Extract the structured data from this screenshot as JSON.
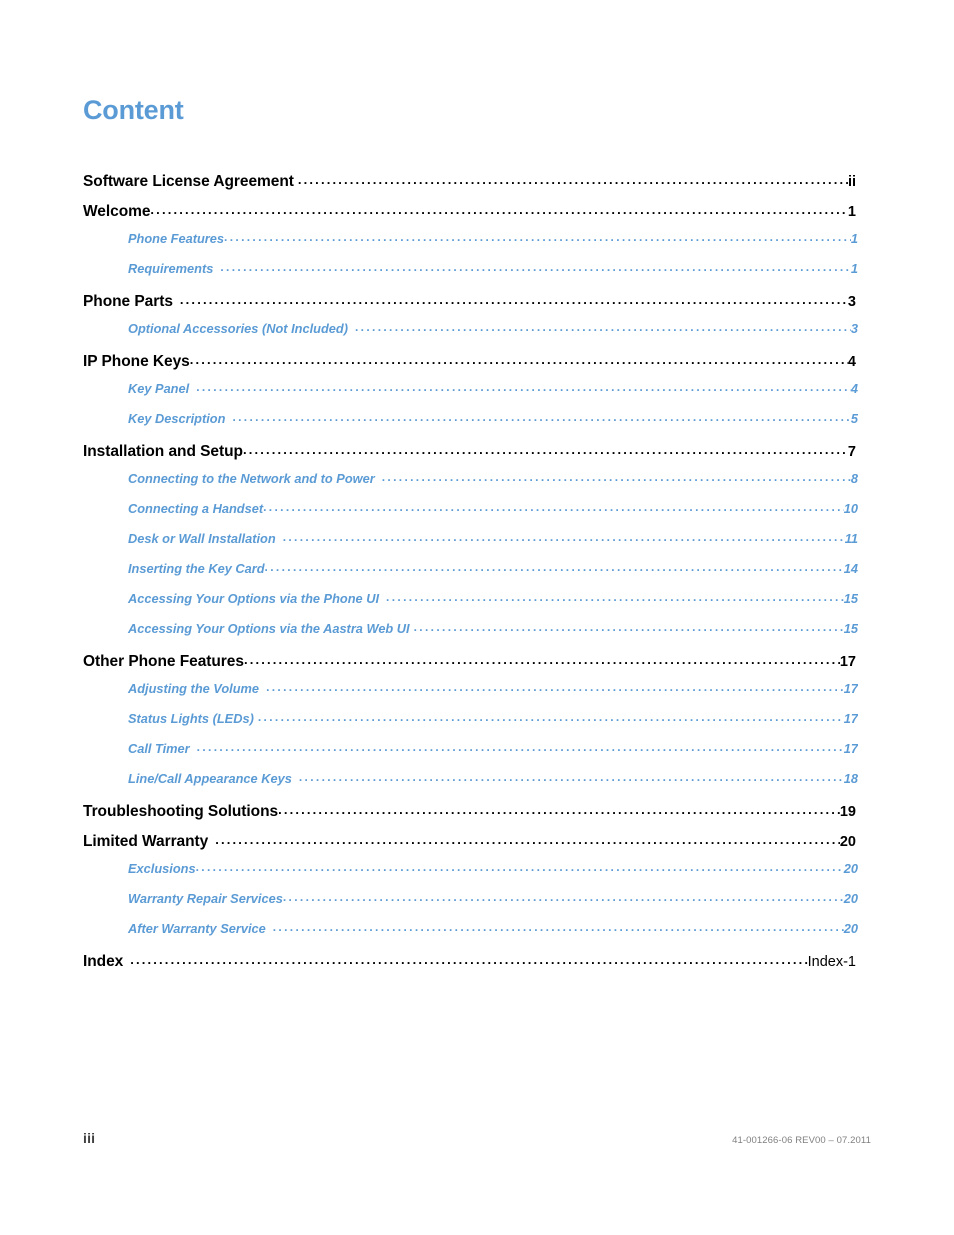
{
  "document": {
    "title": "Content",
    "title_color": "#5B9BD5",
    "level1_color": "#000000",
    "level2_color": "#5B9BD5"
  },
  "toc": {
    "entries": [
      {
        "level": 1,
        "label": "Software License Agreement",
        "page": "ii",
        "gap": 1
      },
      {
        "level": 1,
        "label": "Welcome",
        "page": "1",
        "gap": 0
      },
      {
        "level": 2,
        "label": "Phone Features",
        "page": "1",
        "gap": 0
      },
      {
        "level": 2,
        "label": "Requirements",
        "page": "1",
        "gap": 2
      },
      {
        "level": 1,
        "label": "Phone Parts",
        "page": "3",
        "gap": 2
      },
      {
        "level": 2,
        "label": "Optional Accessories (Not Included)",
        "page": "3",
        "gap": 2
      },
      {
        "level": 1,
        "label": "IP Phone Keys",
        "page": "4",
        "gap": 0
      },
      {
        "level": 2,
        "label": "Key Panel",
        "page": "4",
        "gap": 2
      },
      {
        "level": 2,
        "label": "Key Description",
        "page": "5",
        "gap": 2
      },
      {
        "level": 1,
        "label": "Installation and Setup",
        "page": "7",
        "gap": 0
      },
      {
        "level": 2,
        "label": "Connecting to the Network and to Power",
        "page": "8",
        "gap": 2
      },
      {
        "level": 2,
        "label": "Connecting a Handset",
        "page": "10",
        "gap": 0
      },
      {
        "level": 2,
        "label": "Desk or Wall Installation",
        "page": "11",
        "gap": 2
      },
      {
        "level": 2,
        "label": "Inserting the Key Card",
        "page": "14",
        "gap": 0
      },
      {
        "level": 2,
        "label": "Accessing Your Options via the Phone UI",
        "page": "15",
        "gap": 2
      },
      {
        "level": 2,
        "label": "Accessing Your Options via the Aastra Web UI",
        "page": "15",
        "gap": 1
      },
      {
        "level": 1,
        "label": "Other Phone Features",
        "page": "17",
        "gap": 0
      },
      {
        "level": 2,
        "label": "Adjusting the Volume",
        "page": "17",
        "gap": 2
      },
      {
        "level": 2,
        "label": "Status Lights (LEDs)",
        "page": "17",
        "gap": 1
      },
      {
        "level": 2,
        "label": "Call Timer",
        "page": "17",
        "gap": 2
      },
      {
        "level": 2,
        "label": "Line/Call Appearance Keys",
        "page": "18",
        "gap": 2
      },
      {
        "level": 1,
        "label": "Troubleshooting Solutions",
        "page": "19",
        "gap": 0
      },
      {
        "level": 1,
        "label": "Limited Warranty",
        "page": "20",
        "gap": 2
      },
      {
        "level": 2,
        "label": "Exclusions",
        "page": "20",
        "gap": 0
      },
      {
        "level": 2,
        "label": "Warranty Repair Services",
        "page": "20",
        "gap": 0
      },
      {
        "level": 2,
        "label": "After Warranty Service",
        "page": "20",
        "gap": 2
      },
      {
        "level": 1,
        "label": "Index",
        "page": "Index-1",
        "gap": 2,
        "plain_pageno": true
      }
    ]
  },
  "footer": {
    "page_label": "iii",
    "document_number": "41-001266-06 REV00 – 07.2011"
  }
}
